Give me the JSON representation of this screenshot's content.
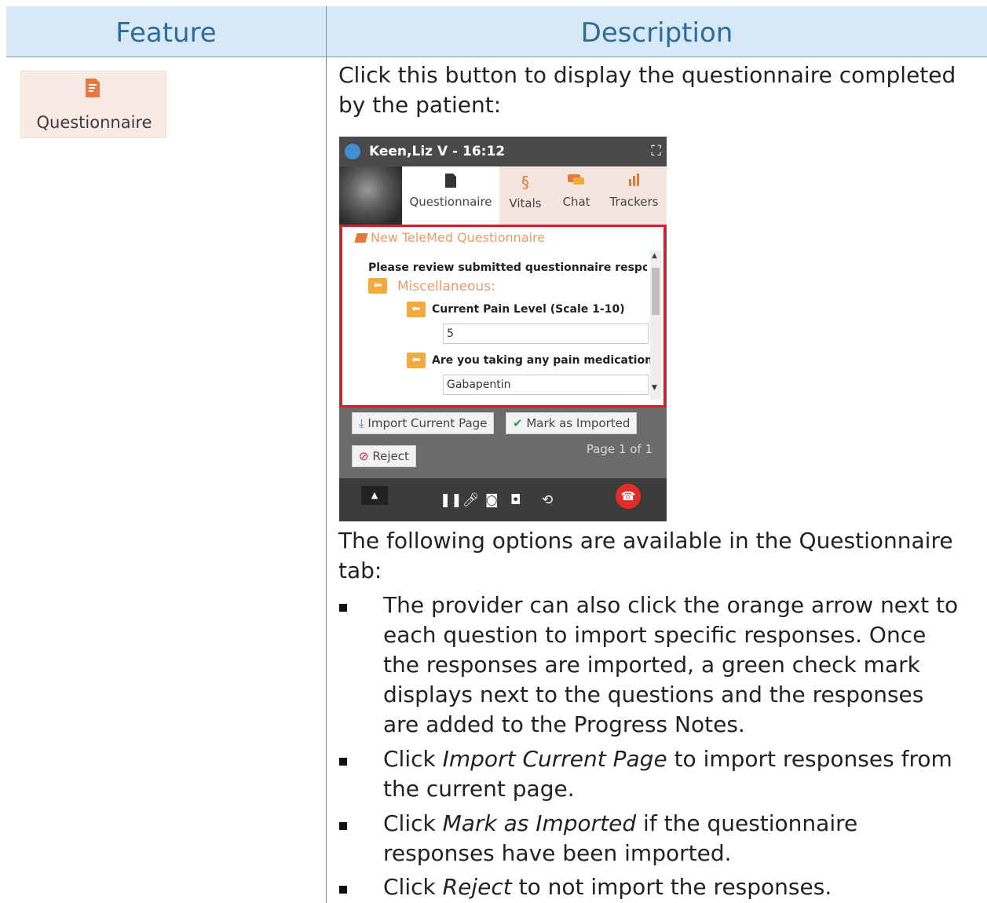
{
  "table": {
    "header_feature": "Feature",
    "header_description": "Description"
  },
  "feature_button": {
    "label": "Questionnaire",
    "icon": "questionnaire-icon"
  },
  "description": {
    "intro": "Click this button to display the questionnaire completed by the patient:",
    "options_intro": "The following options are available in the Questionnaire tab:",
    "bullet1": "The provider can also click the orange arrow next to each question to import specific responses. Once the responses are imported, a green check mark displays next to the questions and the responses are added to the Progress Notes.",
    "bullet2_pre": "Click ",
    "bullet2_em": "Import Current Page",
    "bullet2_post": " to import responses from the current page.",
    "bullet3_pre": "Click ",
    "bullet3_em": "Mark as Imported",
    "bullet3_post": " if the questionnaire responses have been imported.",
    "bullet4_pre": "Click ",
    "bullet4_em": "Reject",
    "bullet4_post": " to not import the responses."
  },
  "screenshot": {
    "title": "Keen,Liz V - 16:12",
    "tabs": [
      "Questionnaire",
      "Vitals",
      "Chat",
      "Trackers"
    ],
    "questionnaire_title": "New TeleMed Questionnaire",
    "review_text": "Please review submitted questionnaire responses",
    "section": "Miscellaneous:",
    "q1_label": "Current Pain Level (Scale 1-10)",
    "q1_value": "5",
    "q2_label": "Are you taking any pain medication?",
    "q2_value": "Gabapentin",
    "import_button": "Import Current Page",
    "mark_button": "Mark as Imported",
    "reject_button": "Reject",
    "page_text": "Page 1 of 1",
    "colors": {
      "accent_orange": "#f3a93c",
      "highlight_red": "#d71e28",
      "header_blue": "#d7e9f7"
    }
  }
}
